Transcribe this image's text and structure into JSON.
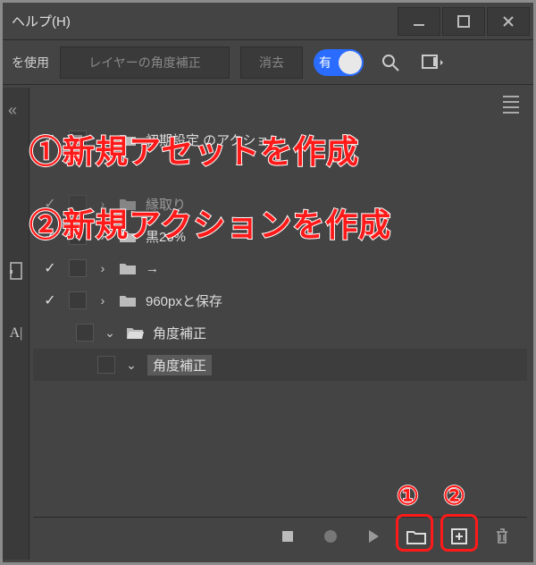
{
  "titlebar": {
    "menu_label": "ヘルプ(H)"
  },
  "optionsbar": {
    "use_label": "を使用",
    "layer_angle_label": "レイヤーの角度補正",
    "clear_label": "消去",
    "toggle_label": "有"
  },
  "actions": {
    "items": [
      {
        "checked": true,
        "mode": "filled",
        "expanded": false,
        "type": "set",
        "label": "初期設定 のアクション",
        "depth": 1
      },
      {
        "checked": true,
        "expanded": false,
        "type": "folder",
        "label": "縁取り",
        "depth": 2,
        "faded": true
      },
      {
        "checked": true,
        "expanded": false,
        "type": "folder",
        "label": "黒20%",
        "depth": 2
      },
      {
        "checked": true,
        "expanded": false,
        "type": "folder",
        "label": "→",
        "depth": 2
      },
      {
        "checked": true,
        "expanded": false,
        "type": "folder",
        "label": "960pxと保存",
        "depth": 2
      },
      {
        "checked": false,
        "expanded": true,
        "type": "folder-open",
        "label": "角度補正",
        "depth": 3
      },
      {
        "checked": false,
        "expanded": true,
        "type": "step",
        "label": "角度補正",
        "depth": 3,
        "selected": true
      }
    ]
  },
  "annotations": {
    "line1": "①新規アセットを作成",
    "line2": "②新規アクションを作成",
    "marker1": "①",
    "marker2": "②"
  }
}
